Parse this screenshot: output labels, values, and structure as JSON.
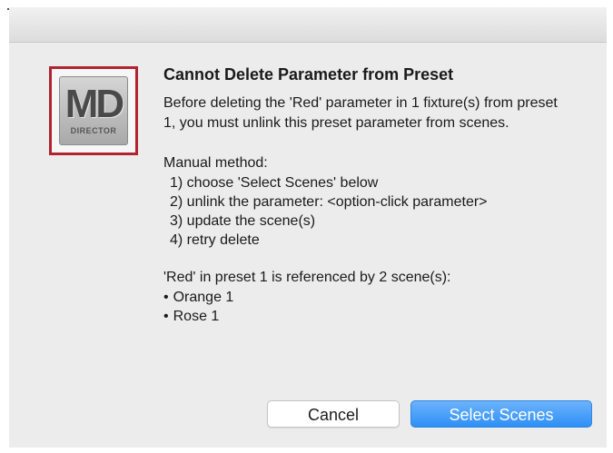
{
  "icon": {
    "name": "md-director-app-icon",
    "logo_text": "MD",
    "logo_subtext": "DIRECTOR",
    "border_color": "#b1242f"
  },
  "dialog": {
    "title": "Cannot Delete Parameter from Preset",
    "intro": "Before deleting the 'Red' parameter in 1 fixture(s) from preset 1, you must unlink this preset parameter from scenes.",
    "method_heading": "Manual method:",
    "steps": [
      "1) choose 'Select Scenes' below",
      "2) unlink the parameter: <option-click parameter>",
      "3) update the scene(s)",
      "4) retry delete"
    ],
    "references_heading": "'Red' in preset 1 is referenced by 2 scene(s):",
    "scenes": [
      "Orange 1",
      "Rose 1"
    ]
  },
  "buttons": {
    "cancel_label": "Cancel",
    "primary_label": "Select Scenes",
    "primary_color": "#2e8ff6"
  }
}
